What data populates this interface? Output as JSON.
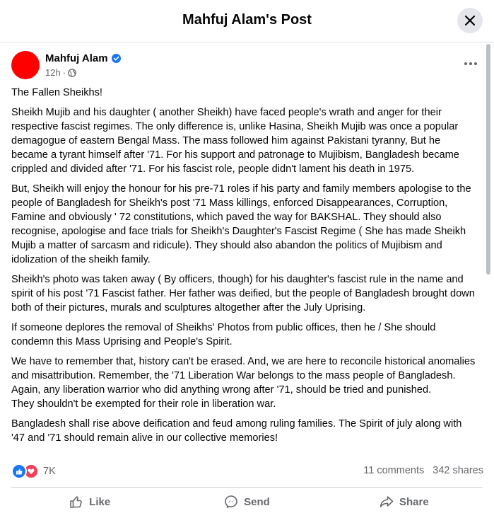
{
  "header": {
    "title": "Mahfuj Alam's Post"
  },
  "post": {
    "author": "Mahfuj Alam",
    "time": "12h",
    "paragraphs": [
      "The Fallen Sheikhs!",
      "Sheikh Mujib and his daughter ( another Sheikh) have faced people's wrath and anger for their respective fascist regimes. The only difference is, unlike Hasina, Sheikh Mujib was once a popular demagogue of eastern Bengal Mass. The mass followed him against Pakistani tyranny, But he became a tyrant himself after '71. For his support and patronage to Mujibism, Bangladesh became crippled and divided after '71. For his fascist role, people didn't lament his death in 1975.",
      "But, Sheikh will enjoy the honour for his pre-71 roles if his party and family members apologise to the people of Bangladesh for Sheikh's post '71  Mass killings, enforced Disappearances, Corruption, Famine and obviously ' 72 constitutions, which paved the way for BAKSHAL. They should also recognise, apologise and face trials for Sheikh's Daughter's Fascist Regime ( She has made Sheikh Mujib a matter of sarcasm and ridicule). They should also abandon the politics of Mujibism and idolization of the sheikh family.",
      "Sheikh's photo was taken away ( By officers, though) for his daughter's fascist rule in the name and spirit of his post '71 Fascist father. Her father was deified, but the people of Bangladesh brought down both of their pictures, murals and sculptures altogether after the July Uprising.",
      "If someone deplores the removal of Sheikhs'  Photos from public offices,  then he / She should condemn this Mass Uprising and People's Spirit.",
      "We have to remember that, history can't be erased. And, we are here to reconcile historical anomalies and misattribution. Remember, the '71 Liberation War belongs to the mass people of Bangladesh. Again, any liberation warrior who did anything wrong after '71, should be tried and punished.\nThey shouldn't be exempted for their role in liberation war.",
      "Bangladesh shall rise above deification and feud among ruling families. The Spirit of july along with '47 and '71 should remain alive in our collective memories!"
    ]
  },
  "engagement": {
    "reaction_count": "7K",
    "comments": "11 comments",
    "shares": "342 shares"
  },
  "actions": {
    "like": "Like",
    "send": "Send",
    "share": "Share"
  },
  "colors": {
    "accent": "#1877f2",
    "love": "#f33e58",
    "avatar": "#ff0000"
  }
}
